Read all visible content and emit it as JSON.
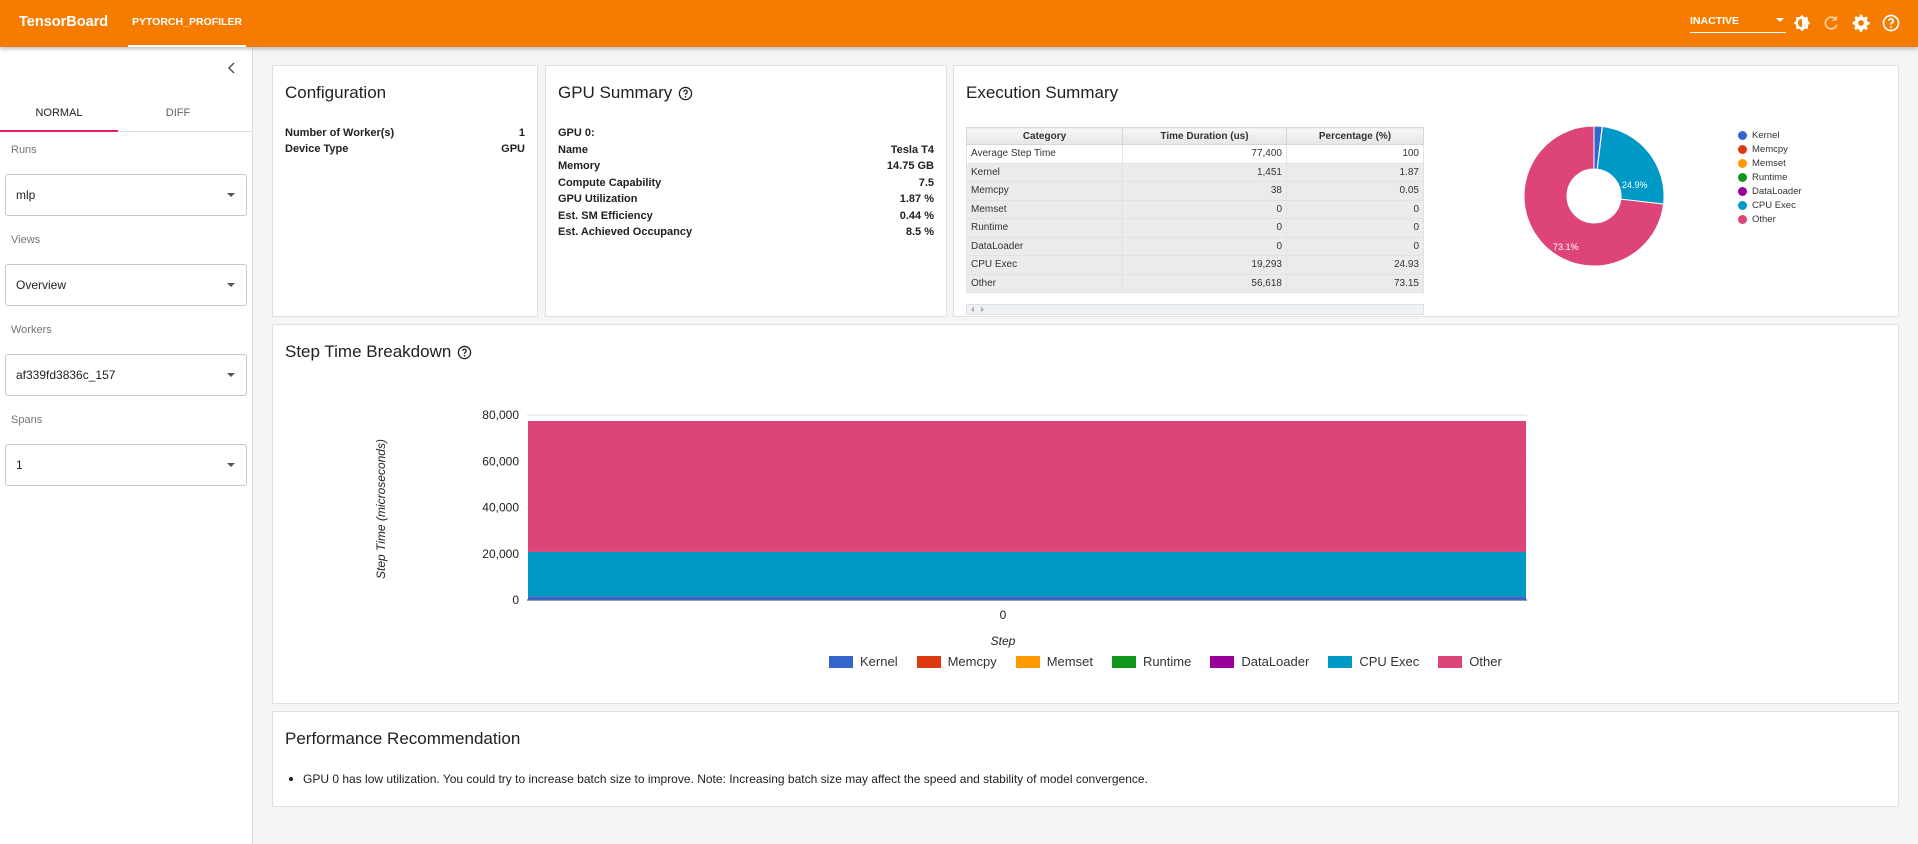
{
  "topbar": {
    "brand": "TensorBoard",
    "active_plugin": "PYTORCH_PROFILER",
    "status_select": "INACTIVE",
    "icons": [
      "dark-mode-icon",
      "refresh-icon",
      "settings-icon",
      "help-icon"
    ],
    "color": "#f57c00"
  },
  "sidebar": {
    "tabs": [
      {
        "label": "NORMAL",
        "active": true
      },
      {
        "label": "DIFF",
        "active": false
      }
    ],
    "runs": {
      "label": "Runs",
      "value": "mlp"
    },
    "views": {
      "label": "Views",
      "value": "Overview"
    },
    "workers": {
      "label": "Workers",
      "value": "af339fd3836c_157"
    },
    "spans": {
      "label": "Spans",
      "value": "1"
    }
  },
  "configuration": {
    "title": "Configuration",
    "rows": [
      {
        "key": "Number of Worker(s)",
        "value": "1"
      },
      {
        "key": "Device Type",
        "value": "GPU"
      }
    ]
  },
  "gpu_summary": {
    "title": "GPU Summary",
    "device_header": "GPU 0:",
    "rows": [
      {
        "key": "Name",
        "value": "Tesla T4"
      },
      {
        "key": "Memory",
        "value": "14.75 GB"
      },
      {
        "key": "Compute Capability",
        "value": "7.5"
      },
      {
        "key": "GPU Utilization",
        "value": "1.87 %"
      },
      {
        "key": "Est. SM Efficiency",
        "value": "0.44 %"
      },
      {
        "key": "Est. Achieved Occupancy",
        "value": "8.5 %"
      }
    ]
  },
  "execution_summary": {
    "title": "Execution Summary",
    "columns": [
      "Category",
      "Time Duration (us)",
      "Percentage (%)"
    ],
    "rows": [
      [
        "Average Step Time",
        "77,400",
        "100"
      ],
      [
        "Kernel",
        "1,451",
        "1.87"
      ],
      [
        "Memcpy",
        "38",
        "0.05"
      ],
      [
        "Memset",
        "0",
        "0"
      ],
      [
        "Runtime",
        "0",
        "0"
      ],
      [
        "DataLoader",
        "0",
        "0"
      ],
      [
        "CPU Exec",
        "19,293",
        "24.93"
      ],
      [
        "Other",
        "56,618",
        "73.15"
      ]
    ],
    "pie_labels": {
      "cpu_exec": "24.9%",
      "other": "73.1%"
    }
  },
  "step_time": {
    "title": "Step Time Breakdown",
    "ylabel": "Step Time (microseconds)",
    "xlabel": "Step"
  },
  "recommendation": {
    "title": "Performance Recommendation",
    "items": [
      "GPU 0 has low utilization. You could try to increase batch size to improve. Note: Increasing batch size may affect the speed and stability of model convergence."
    ]
  },
  "chart_data": [
    {
      "type": "pie",
      "donut": true,
      "categories": [
        "Kernel",
        "Memcpy",
        "Memset",
        "Runtime",
        "DataLoader",
        "CPU Exec",
        "Other"
      ],
      "values": [
        1.87,
        0.05,
        0,
        0,
        0,
        24.93,
        73.15
      ],
      "colors": [
        "#3366cc",
        "#dc3912",
        "#ff9900",
        "#109618",
        "#990099",
        "#0099c6",
        "#dd4477"
      ],
      "legend": "right"
    },
    {
      "type": "area",
      "stacked": true,
      "title": "Step Time Breakdown",
      "xlabel": "Step",
      "ylabel": "Step Time (microseconds)",
      "x": [
        "0"
      ],
      "ylim": [
        0,
        80000
      ],
      "yticks": [
        "80,000",
        "60,000",
        "40,000",
        "20,000",
        "0"
      ],
      "series": [
        {
          "name": "Kernel",
          "values": [
            1451
          ],
          "color": "#3366cc"
        },
        {
          "name": "Memcpy",
          "values": [
            38
          ],
          "color": "#dc3912"
        },
        {
          "name": "Memset",
          "values": [
            0
          ],
          "color": "#ff9900"
        },
        {
          "name": "Runtime",
          "values": [
            0
          ],
          "color": "#109618"
        },
        {
          "name": "DataLoader",
          "values": [
            0
          ],
          "color": "#990099"
        },
        {
          "name": "CPU Exec",
          "values": [
            19293
          ],
          "color": "#0099c6"
        },
        {
          "name": "Other",
          "values": [
            56618
          ],
          "color": "#dd4477"
        }
      ],
      "legend": "bottom"
    }
  ]
}
